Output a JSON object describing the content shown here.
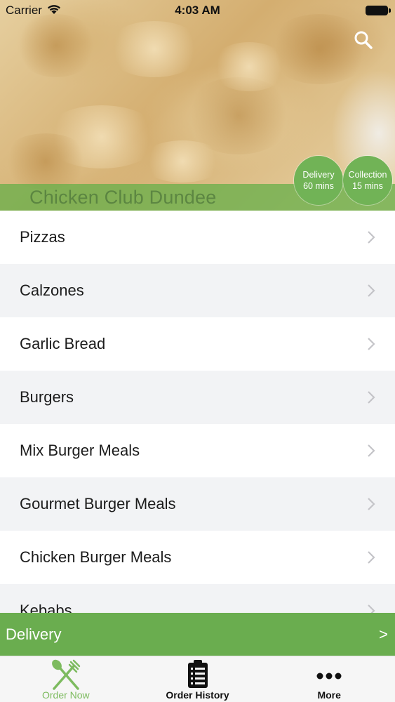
{
  "status_bar": {
    "carrier": "Carrier",
    "time": "4:03 AM"
  },
  "hero": {
    "restaurant_name": "Chicken Club Dundee",
    "delivery_badge": {
      "label": "Delivery",
      "time": "60 mins"
    },
    "collection_badge": {
      "label": "Collection",
      "time": "15 mins"
    }
  },
  "menu": {
    "items": [
      {
        "label": "Pizzas"
      },
      {
        "label": "Calzones"
      },
      {
        "label": "Garlic Bread"
      },
      {
        "label": "Burgers"
      },
      {
        "label": "Mix Burger Meals"
      },
      {
        "label": "Gourmet Burger Meals"
      },
      {
        "label": "Chicken Burger Meals"
      },
      {
        "label": "Kebabs"
      }
    ]
  },
  "delivery_bar": {
    "label": "Delivery",
    "arrow": ">"
  },
  "tab_bar": {
    "tabs": [
      {
        "label": "Order Now",
        "icon": "fork-knife-icon"
      },
      {
        "label": "Order History",
        "icon": "clipboard-list-icon"
      },
      {
        "label": "More",
        "icon": "more-dots-icon"
      }
    ]
  },
  "colors": {
    "accent": "#6aad4f",
    "badge": "#71b356",
    "active_tab": "#7dbb5f"
  }
}
